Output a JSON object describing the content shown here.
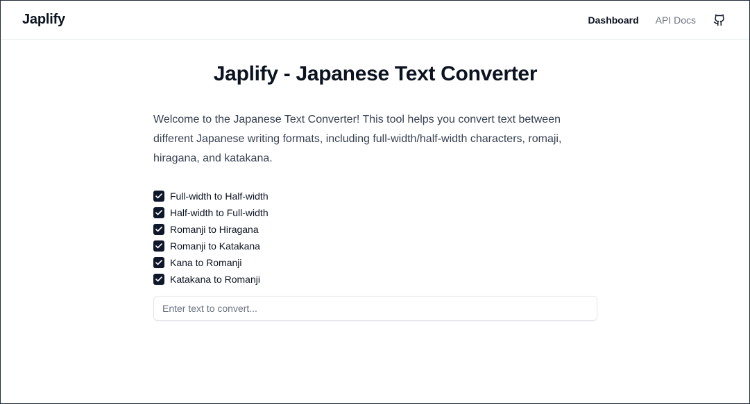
{
  "navbar": {
    "brand": "Japlify",
    "links": [
      {
        "label": "Dashboard",
        "active": true
      },
      {
        "label": "API Docs",
        "active": false
      }
    ],
    "github_icon": "github-icon"
  },
  "main": {
    "title": "Japlify - Japanese Text Converter",
    "intro": "Welcome to the Japanese Text Converter! This tool helps you convert text between different Japanese writing formats, including full-width/half-width characters, romaji, hiragana, and katakana.",
    "options": [
      {
        "label": "Full-width to Half-width",
        "checked": true
      },
      {
        "label": "Half-width to Full-width",
        "checked": true
      },
      {
        "label": "Romanji to Hiragana",
        "checked": true
      },
      {
        "label": "Romanji to Katakana",
        "checked": true
      },
      {
        "label": "Kana to Romanji",
        "checked": true
      },
      {
        "label": "Katakana to Romanji",
        "checked": true
      }
    ],
    "input": {
      "placeholder": "Enter text to convert...",
      "value": ""
    }
  },
  "colors": {
    "text_primary": "#0b1220",
    "text_muted": "#6b7280",
    "checkbox_fill": "#0f172a",
    "border": "#e5e7eb"
  }
}
